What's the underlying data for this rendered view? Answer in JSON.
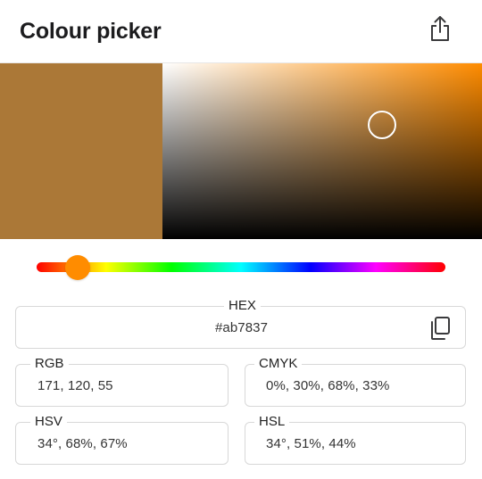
{
  "header": {
    "title": "Colour picker",
    "share_icon": "share-icon"
  },
  "colors": {
    "current": "#ab7837",
    "hue_pure": "#ff8c00",
    "hue_thumb": "#ff8c00"
  },
  "picker": {
    "saturation_percent": 68,
    "value_percent": 67,
    "hue_degrees": 34
  },
  "fields": {
    "hex": {
      "label": "HEX",
      "value": "#ab7837",
      "copy_icon": "copy-icon"
    },
    "rgb": {
      "label": "RGB",
      "value": "171, 120, 55"
    },
    "cmyk": {
      "label": "CMYK",
      "value": "0%, 30%, 68%, 33%"
    },
    "hsv": {
      "label": "HSV",
      "value": "34°, 68%, 67%"
    },
    "hsl": {
      "label": "HSL",
      "value": "34°, 51%, 44%"
    }
  }
}
